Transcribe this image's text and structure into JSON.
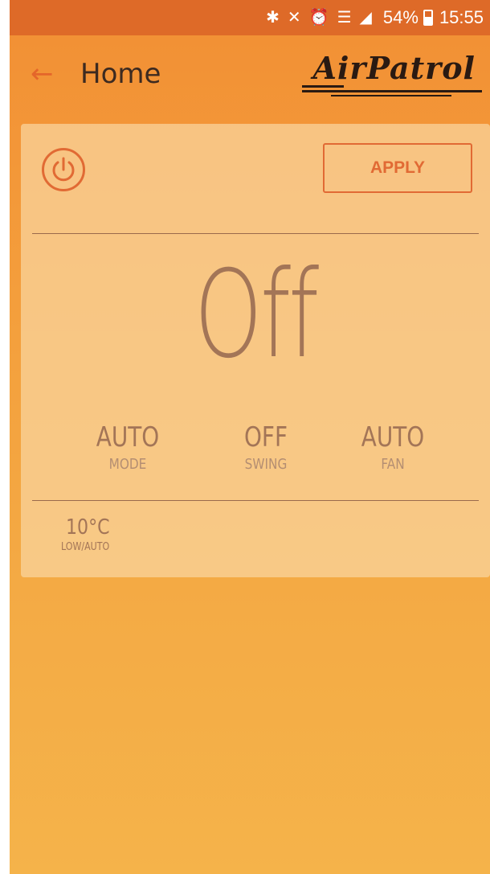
{
  "status_bar": {
    "icons": [
      "bluetooth-icon",
      "mute-icon",
      "alarm-icon",
      "wifi-icon",
      "signal-icon",
      "battery-icon"
    ],
    "battery": "54%",
    "time": "15:55"
  },
  "app_bar": {
    "title": "Home",
    "logo_text": "AirPatrol"
  },
  "card": {
    "apply_label": "APPLY",
    "power_state": "Off",
    "settings": [
      {
        "value": "AUTO",
        "label": "MODE"
      },
      {
        "value": "OFF",
        "label": "SWING"
      },
      {
        "value": "AUTO",
        "label": "FAN"
      }
    ],
    "temperature": {
      "value": "10°C",
      "label": "LOW/AUTO"
    }
  },
  "colors": {
    "accent": "#e16a34",
    "status_bar": "#de6a28",
    "text_muted": "#a37557"
  }
}
